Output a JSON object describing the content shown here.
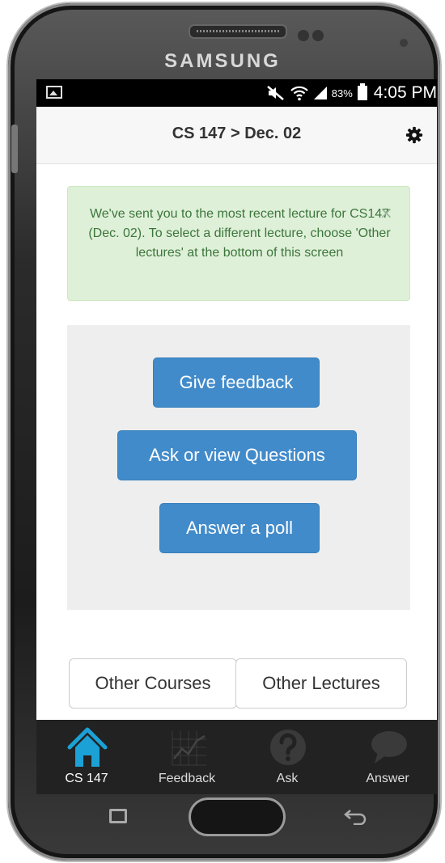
{
  "device": {
    "brand": "SAMSUNG"
  },
  "status_bar": {
    "battery": "83%",
    "time": "4:05 PM"
  },
  "header": {
    "title": "CS 147 > Dec. 02"
  },
  "alert": {
    "message": "We've sent you to the most recent lecture for CS147 (Dec. 02). To select a different lecture, choose 'Other lectures' at the bottom of this screen",
    "close_symbol": "×",
    "color": "#3c763d",
    "background": "#dff0d8"
  },
  "actions": {
    "give_feedback": "Give feedback",
    "ask_questions": "Ask or view Questions",
    "answer_poll": "Answer a poll",
    "color": "#428bca"
  },
  "navigation": {
    "other_courses": "Other Courses",
    "other_lectures": "Other Lectures"
  },
  "tabs": [
    {
      "label": "CS 147",
      "icon": "home-icon",
      "active": true,
      "color": "#1ba1d6"
    },
    {
      "label": "Feedback",
      "icon": "chart-icon",
      "active": false
    },
    {
      "label": "Ask",
      "icon": "question-icon",
      "active": false
    },
    {
      "label": "Answer",
      "icon": "speech-bubble-icon",
      "active": false
    }
  ]
}
